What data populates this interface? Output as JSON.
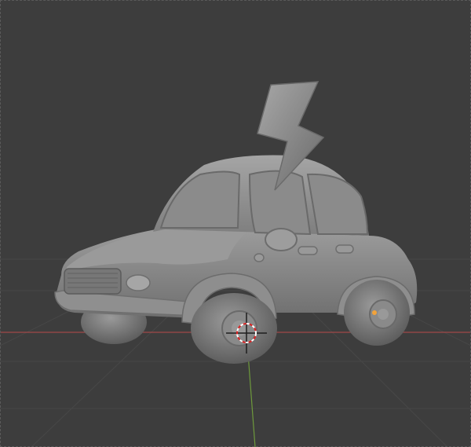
{
  "viewport": {
    "mode": "3d-viewport",
    "shading": "solid",
    "background_color": "#3d3d3d",
    "grid_color": "#4a4a4a",
    "x_axis_color": "#a14a4a",
    "y_axis_color": "#6e9a3c",
    "model_color": "#8a8a8a",
    "origin_color": "#f2a33a"
  },
  "scene": {
    "objects": [
      {
        "name_icon": "car-model"
      },
      {
        "name_icon": "lightning-bolt-model"
      }
    ],
    "cursor_icon": "3d-cursor-icon"
  }
}
